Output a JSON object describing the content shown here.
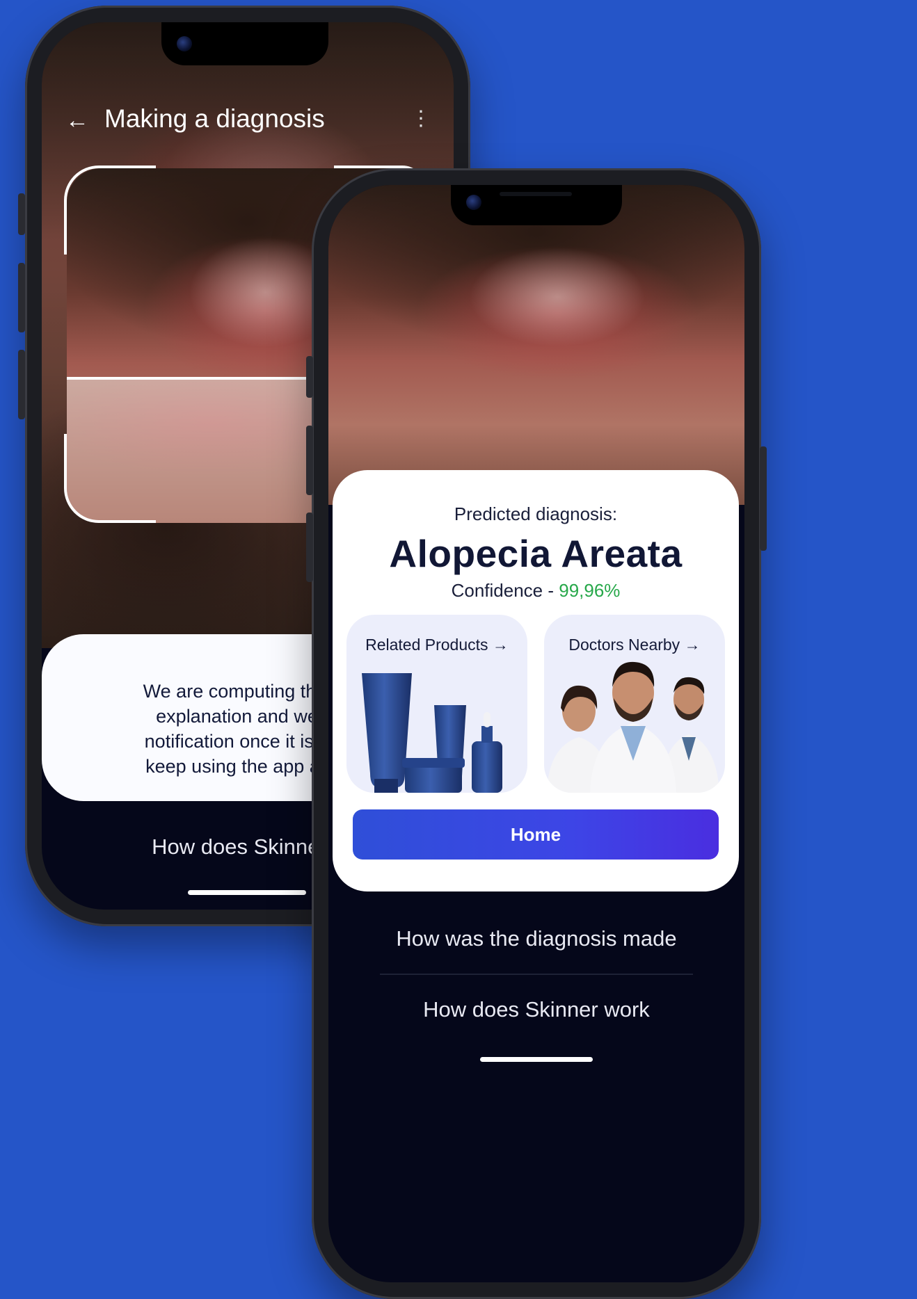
{
  "back_phone": {
    "header": {
      "back_icon": "←",
      "title": "Making a diagnosis",
      "menu_icon": "⋮"
    },
    "info_lines": [
      "We are computing the SH",
      "explanation and we wil",
      "notification once it is read",
      "keep using the app and c"
    ],
    "link": "How does Skinner v"
  },
  "front_phone": {
    "result": {
      "label": "Predicted diagnosis:",
      "diagnosis": "Alopecia Areata",
      "confidence_label": "Confidence - ",
      "confidence_value": "99,96%"
    },
    "tiles": [
      {
        "label": "Related Products →"
      },
      {
        "label": "Doctors Nearby →"
      }
    ],
    "home_button": "Home",
    "links": [
      "How was the diagnosis made",
      "How does Skinner work"
    ]
  },
  "colors": {
    "background": "#2555c8",
    "confidence": "#27a84a",
    "button_start": "#2f4fd8",
    "button_end": "#4a2ee0",
    "dark_panel": "#05071a"
  },
  "icons": [
    "arrow-left-icon",
    "more-vertical-icon",
    "arrow-right-icon"
  ]
}
